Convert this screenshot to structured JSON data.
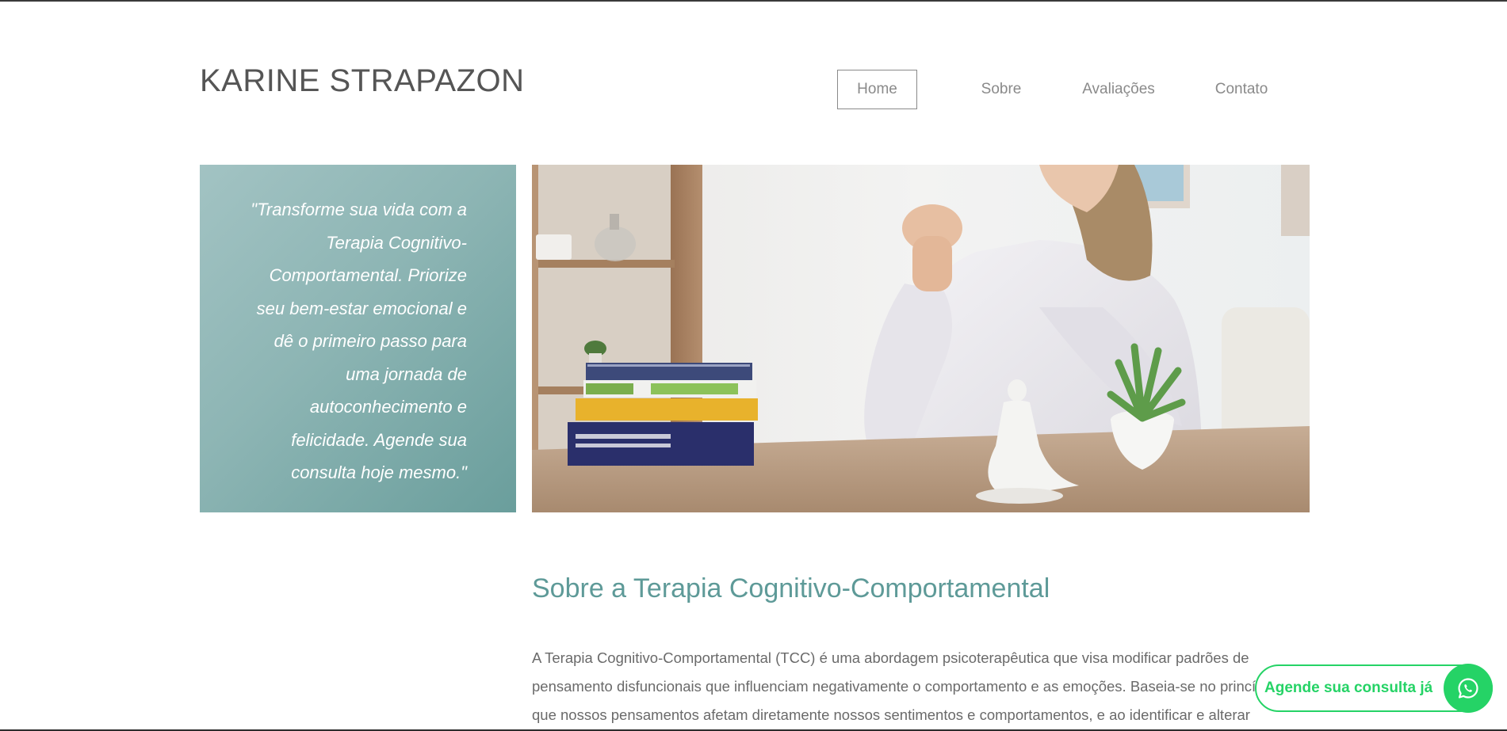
{
  "header": {
    "site_title": "KARINE STRAPAZON",
    "nav": [
      {
        "label": "Home",
        "active": true
      },
      {
        "label": "Sobre",
        "active": false
      },
      {
        "label": "Avaliações",
        "active": false
      },
      {
        "label": "Contato",
        "active": false
      }
    ]
  },
  "hero": {
    "quote_lines": [
      "\"Transforme sua vida com a",
      "Terapia Cognitivo-",
      "Comportamental. Priorize",
      "seu bem-estar emocional e",
      "dê o primeiro passo para",
      "uma jornada de",
      "autoconhecimento e",
      "felicidade. Agende sua",
      "consulta hoje mesmo.\""
    ]
  },
  "about": {
    "title": "Sobre a Terapia Cognitivo-Comportamental",
    "body": "A Terapia Cognitivo-Comportamental (TCC) é uma abordagem psicoterapêutica que visa modificar padrões de pensamento disfuncionais que influenciam negativamente o comportamento e as emoções. Baseia-se no princípio de que nossos pensamentos afetam diretamente nossos sentimentos e comportamentos, e ao identificar e alterar"
  },
  "whatsapp": {
    "label": "Agende sua consulta já",
    "icon": "whatsapp-icon"
  },
  "colors": {
    "accent": "#5e9a98",
    "quote_bg": "#8db5b4",
    "whatsapp": "#25d366",
    "title_text": "#555555"
  }
}
